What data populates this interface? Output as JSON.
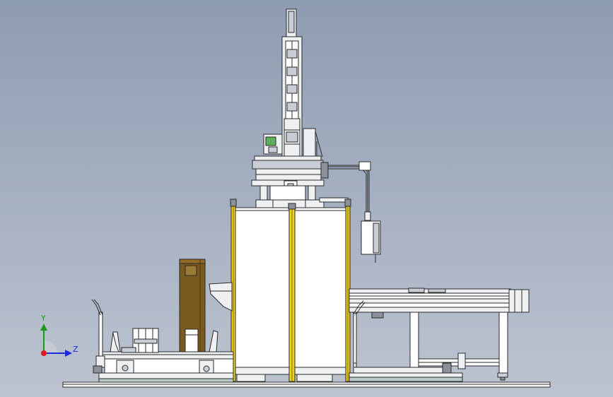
{
  "triad": {
    "y_label": "Y",
    "z_label": "Z",
    "colors": {
      "x": "#e01b1b",
      "y": "#1a9a1a",
      "z": "#1f2bd6"
    }
  },
  "colors": {
    "background_top": "#8e9bb1",
    "background_bottom": "#bdc4d0",
    "light_curtain": "#f2d21a",
    "cabinet": "#7a5a1e"
  }
}
